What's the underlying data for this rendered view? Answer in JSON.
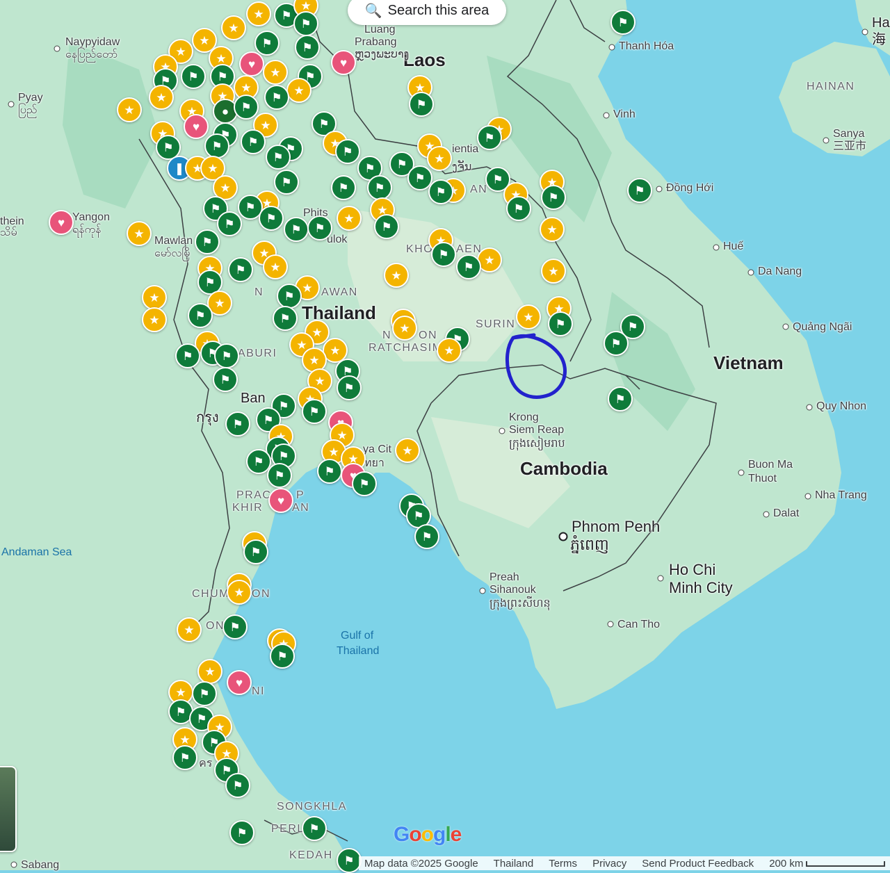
{
  "search_button": {
    "label": "Search this area",
    "icon": "search-icon"
  },
  "countries": [
    {
      "name": "Laos"
    },
    {
      "name": "Thailand"
    },
    {
      "name": "Vietnam"
    },
    {
      "name": "Cambodia"
    }
  ],
  "regions": [
    "KHON KAEN",
    "SURIN",
    "NAKHON RATCHASIMA",
    "SONGKHLA",
    "KEDAH",
    "PERLIS",
    "HAINAN",
    "CHUMPHON",
    "PRACHUAP KHIRI KHAN",
    "NAKHON SAWAN",
    "KANCHANABURI"
  ],
  "region_labels": {
    "khon_kaen": "KHON KAEN",
    "surin": "SURIN",
    "nakhon_ratchasima_1": "N",
    "nakhon_ratchasima_2": "RATCHASIM",
    "nakhon_ratchasima_3": "ON",
    "songkhla": "SONGKHLA",
    "kedah": "KEDAH",
    "perlis": "PERL",
    "hainan": "HAINAN",
    "chumphon_1": "CHUM",
    "chumphon_2": "ON",
    "prachuap_1": "PRAC",
    "prachuap_2": "KHIR",
    "prachuap_3": "P",
    "prachuap_4": "AN",
    "nakhon_sawan_1": "N",
    "nakhon_sawan_2": "AWAN",
    "kanchanaburi": "ABURI",
    "khon_kaen_1": "KHO",
    "khon_kaen_2": "AEN",
    "surat_1": "NI",
    "nakhon_si_1": "ON"
  },
  "water_labels": {
    "andaman": "Andaman Sea",
    "gulf_1": "Gulf of",
    "gulf_2": "Thailand"
  },
  "cities": {
    "naypyidaw": "Naypyidaw",
    "naypyidaw_local": "နေပြည်တော်",
    "pyay": "Pyay",
    "pyay_local": "ပြည်",
    "yangon": "Yangon",
    "yangon_local": "ရန်ကုန်",
    "pathein": "thein",
    "pathein_local": "သိမ်",
    "mawlamyine": "Mawlan",
    "mawlamyine_local": "မော်လမြိ",
    "luang_prabang_1": "Luang",
    "luang_prabang_2": "Prabang",
    "luang_prabang_local": "ຫຼວງພະບາງ",
    "vientiane": "ientia",
    "vientiane_local": "ງຈັນ",
    "phitsanulok": "Phits",
    "phitsanulok_2": "ulok",
    "thanh_hoa": "Thanh Hóa",
    "vinh": "Vinh",
    "dong_hoi": "Đồng Hới",
    "hue": "Huế",
    "da_nang": "Da Nang",
    "quang_ngai": "Quảng Ngãi",
    "quy_nhon": "Quy Nhon",
    "buon_ma_thuot_1": "Buon Ma",
    "buon_ma_thuot_2": "Thuot",
    "nha_trang": "Nha Trang",
    "dalat": "Dalat",
    "ho_chi_minh_1": "Ho Chi",
    "ho_chi_minh_2": "Minh City",
    "can_tho": "Can Tho",
    "phnom_penh": "Phnom Penh",
    "phnom_penh_local": "ភ្នំពេញ",
    "siem_reap_1": "Krong",
    "siem_reap_2": "Siem Reap",
    "siem_reap_local": "ក្រុងសៀមរាប",
    "sihanoukville_1": "Preah",
    "sihanoukville_2": "Sihanouk",
    "sihanoukville_local": "ក្រុងព្រះសីហនុ",
    "pattaya": "ya Cit",
    "pattaya_local": "ัทยา",
    "bangkok": "Ban",
    "bangkok_local": "กรุง",
    "hanoi": "Ha",
    "hanoi_local": "海",
    "sanya": "Sanya",
    "sanya_local": "三亚市",
    "sabang": "Sabang",
    "an": "AN",
    "ni": "NI",
    "khr": "คร"
  },
  "footer": {
    "map_data": "Map data ©2025 Google",
    "country": "Thailand",
    "terms": "Terms",
    "privacy": "Privacy",
    "feedback": "Send Product Feedback",
    "scale": "200 km"
  },
  "google_logo": {
    "letters": [
      "G",
      "o",
      "o",
      "g",
      "l",
      "e"
    ],
    "colors": [
      "#4285f4",
      "#ea4335",
      "#fbbc05",
      "#4285f4",
      "#34a853",
      "#ea4335"
    ]
  },
  "colors": {
    "water": "#7dd3e8",
    "land": "#bfe6cf",
    "land_dark": "#a8dcc0",
    "border": "#3c4043",
    "star_pin": "#f4b400",
    "flag_pin": "#0f7b3a",
    "heart_pin": "#e8547a",
    "annotation_circle": "#2222cc"
  },
  "pin_icons": {
    "star": "★",
    "flag": "⚑",
    "heart": "♥",
    "bookmark": "❚",
    "dot": "●"
  }
}
